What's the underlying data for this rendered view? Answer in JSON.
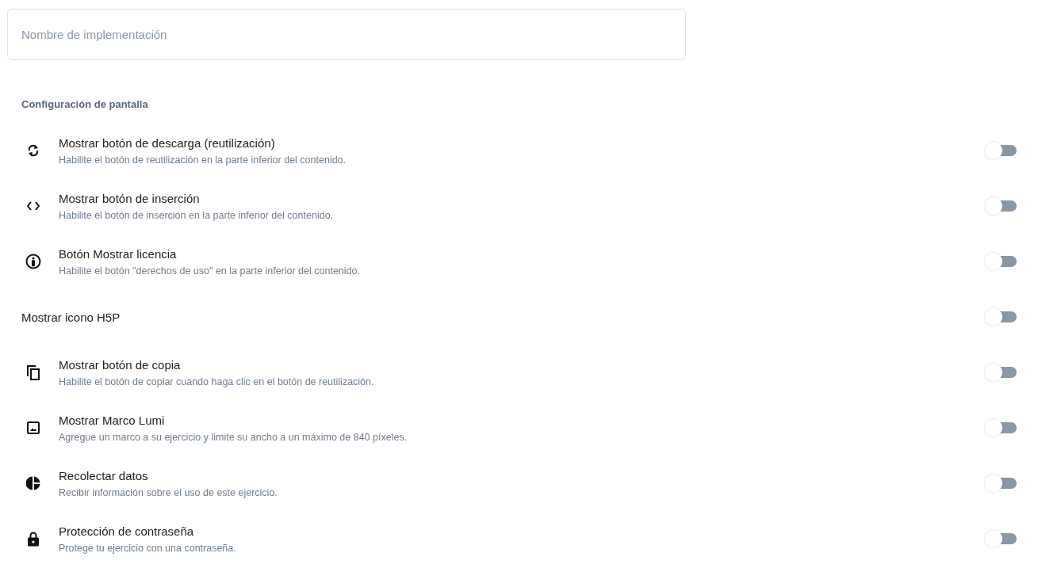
{
  "name_field": {
    "placeholder": "Nombre de implementación"
  },
  "section_title": "Configuración de pantalla",
  "settings": [
    {
      "kind": "described",
      "title": "Mostrar botón de descarga (reutilización)",
      "description": "Habilite el botón de reutilización en la parte inferior del contenido.",
      "on": false
    },
    {
      "kind": "described",
      "title": "Mostrar botón de inserción",
      "description": "Habilite el botón de inserción en la parte inferior del contenido.",
      "on": false
    },
    {
      "kind": "described",
      "title": "Botón Mostrar licencia",
      "description": "Habilite el botón \"derechos de uso\" en la parte inferior del contenido.",
      "on": false
    },
    {
      "kind": "plain",
      "title": "Mostrar icono H5P",
      "on": false
    },
    {
      "kind": "described",
      "title": "Mostrar botón de copia",
      "description": "Habilite el botón de copiar cuando haga clic en el botón de reutilización.",
      "on": false
    },
    {
      "kind": "described",
      "title": "Mostrar Marco Lumi",
      "description": "Agregue un marco a su ejercicio y limite su ancho a un máximo de 840 píxeles.",
      "on": false
    },
    {
      "kind": "described",
      "title": "Recolectar datos",
      "description": "Recibir información sobre el uso de este ejercicio.",
      "on": false
    },
    {
      "kind": "described",
      "title": "Protección de contraseña",
      "description": "Protege tu ejercicio con una contraseña.",
      "on": false
    }
  ]
}
